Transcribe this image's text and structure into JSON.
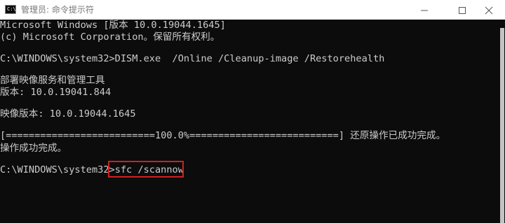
{
  "window": {
    "title": "管理员: 命令提示符",
    "icon_text": "C:\\",
    "controls": {
      "minimize_icon": "minimize-icon",
      "maximize_icon": "maximize-icon",
      "close_icon": "close-icon"
    },
    "colors": {
      "console_bg": "#0c0c0c",
      "console_text": "#cccccc",
      "highlight": "#d21f1f"
    }
  },
  "console": {
    "lines": [
      "Microsoft Windows [版本 10.0.19044.1645]",
      "(c) Microsoft Corporation。保留所有权利。",
      "C:\\WINDOWS\\system32>DISM.exe  /Online /Cleanup-image /Restorehealth",
      "部署映像服务和管理工具",
      "版本: 10.0.19041.844",
      "映像版本: 10.0.19044.1645",
      "[==========================100.0%==========================] 还原操作已成功完成。",
      "操作成功完成。"
    ],
    "prompt": "C:\\WINDOWS\\system32>",
    "command": "sfc /scannow"
  }
}
